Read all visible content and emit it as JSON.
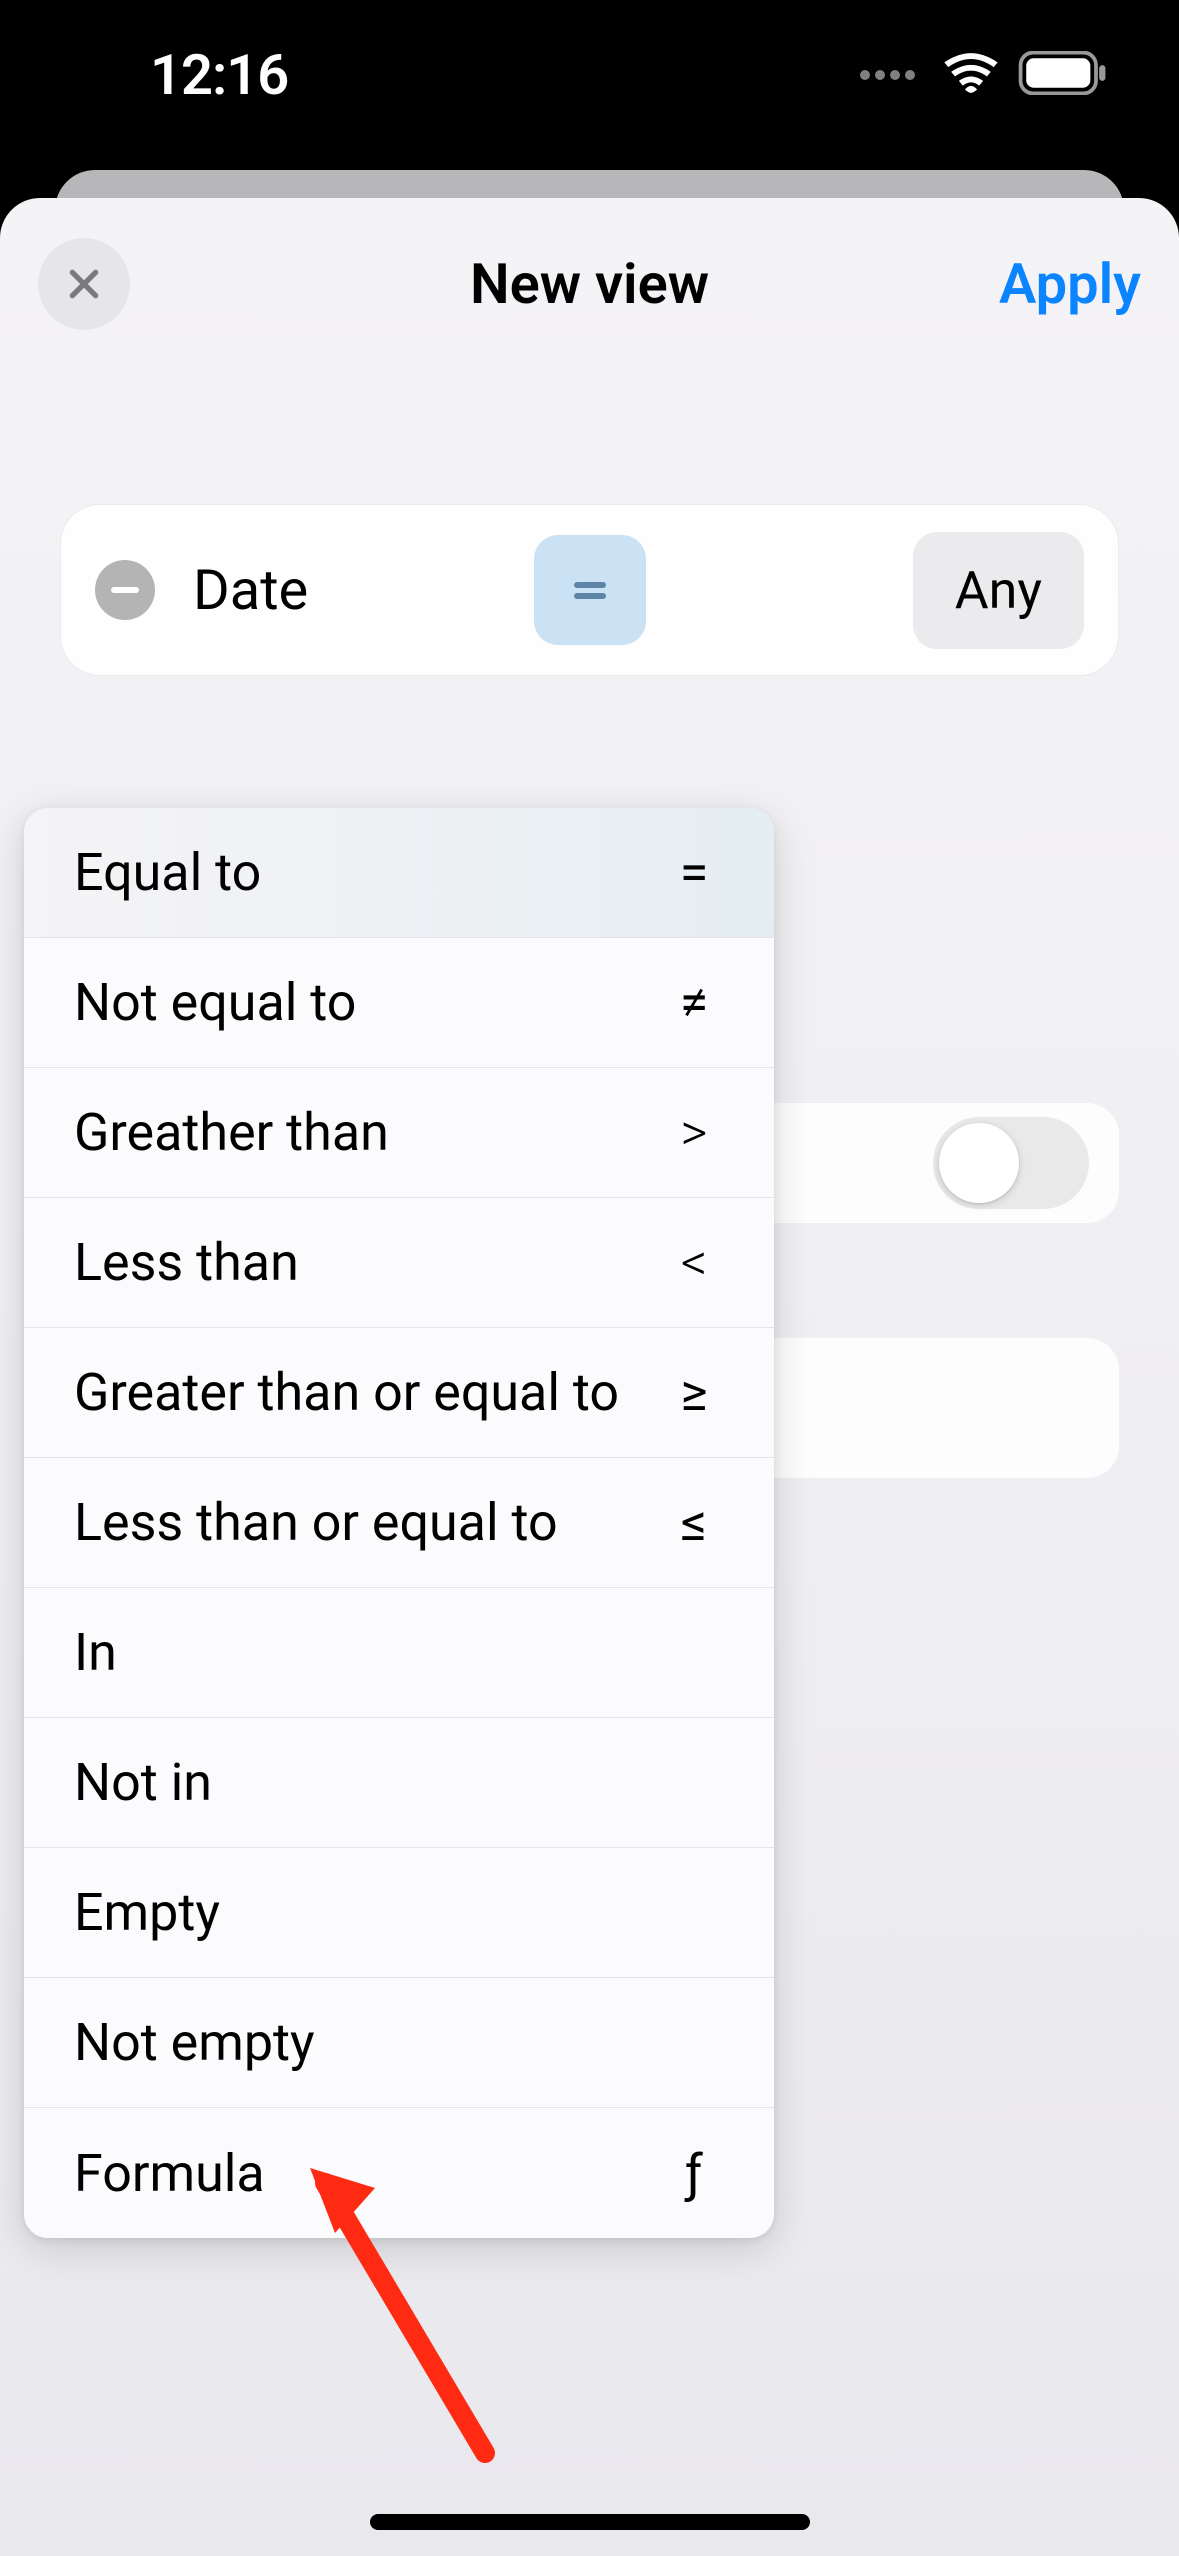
{
  "status": {
    "time": "12:16"
  },
  "sheet": {
    "title": "New view",
    "apply_label": "Apply"
  },
  "filter": {
    "field_label": "Date",
    "value_label": "Any"
  },
  "operators": [
    {
      "label": "Equal to",
      "symbol": "="
    },
    {
      "label": "Not equal to",
      "symbol": "≠"
    },
    {
      "label": "Greather than",
      "symbol": ">"
    },
    {
      "label": "Less than",
      "symbol": "<"
    },
    {
      "label": "Greater than or equal to",
      "symbol": "≥"
    },
    {
      "label": "Less than or equal to",
      "symbol": "≤"
    },
    {
      "label": "In",
      "symbol": ""
    },
    {
      "label": "Not in",
      "symbol": ""
    },
    {
      "label": "Empty",
      "symbol": ""
    },
    {
      "label": "Not empty",
      "symbol": ""
    },
    {
      "label": "Formula",
      "symbol": "ƒ"
    }
  ],
  "selected_operator_index": 0,
  "colors": {
    "accent": "#0a84ff",
    "operator_chip_bg": "#cbe2f4",
    "annotation": "#ff2a12"
  }
}
